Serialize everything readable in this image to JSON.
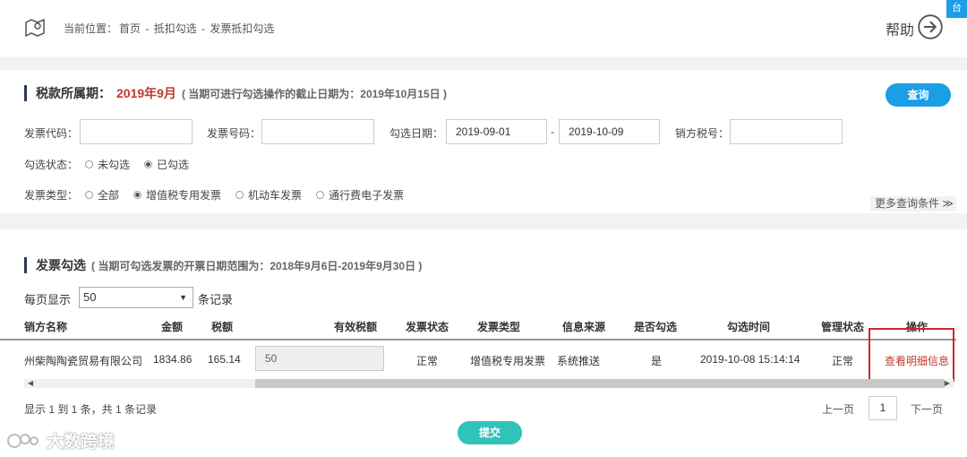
{
  "breadcrumb": {
    "prefix": "当前位置：",
    "home": "首页",
    "sep1": " - ",
    "level1": "抵扣勾选",
    "sep2": " - ",
    "level2": "发票抵扣勾选"
  },
  "help_label": "帮助",
  "corner_tab": "台",
  "tax_period": {
    "title": "税款所属期：",
    "period": "2019年9月",
    "note": "( 当期可进行勾选操作的截止日期为：2019年10月15日 )"
  },
  "query_button": "查询",
  "filters": {
    "invoice_code_label": "发票代码：",
    "invoice_code_value": "",
    "invoice_number_label": "发票号码：",
    "invoice_number_value": "",
    "check_date_label": "勾选日期：",
    "date_from": "2019-09-01",
    "date_sep": "-",
    "date_to": "2019-10-09",
    "seller_tax_label": "销方税号：",
    "seller_tax_value": "",
    "status_label": "勾选状态：",
    "status_options": [
      {
        "label": "未勾选",
        "selected": false
      },
      {
        "label": "已勾选",
        "selected": true
      }
    ],
    "type_label": "发票类型：",
    "type_options": [
      {
        "label": "全部",
        "selected": false
      },
      {
        "label": "增值税专用发票",
        "selected": true
      },
      {
        "label": "机动车发票",
        "selected": false
      },
      {
        "label": "通行费电子发票",
        "selected": false
      }
    ],
    "more_conditions": "更多查询条件 ≫"
  },
  "invoice_section": {
    "title": "发票勾选",
    "note": "( 当期可勾选发票的开票日期范围为：2018年9月6日-2019年9月30日 )",
    "per_page_label": "每页显示",
    "per_page_value": "50",
    "per_page_suffix": "条记录"
  },
  "table": {
    "headers": [
      "销方名称",
      "金额",
      "税额",
      "有效税额",
      "发票状态",
      "发票类型",
      "信息来源",
      "是否勾选",
      "勾选时间",
      "管理状态",
      "操作"
    ],
    "rows": [
      {
        "seller": "州柴陶陶瓷贸易有限公司",
        "amount": "1834.86",
        "tax": "165.14",
        "valid_tax": "50",
        "status": "正常",
        "type": "增值税专用发票",
        "source": "系统推送",
        "checked": "是",
        "check_time": "2019-10-08 15:14:14",
        "manage_status": "正常",
        "action": "查看明细信息"
      }
    ]
  },
  "pagination": {
    "summary": "显示 1 到 1 条，共 1 条记录",
    "prev": "上一页",
    "current": "1",
    "next": "下一页"
  },
  "submit_button": "提交",
  "watermark": "大数跨境"
}
